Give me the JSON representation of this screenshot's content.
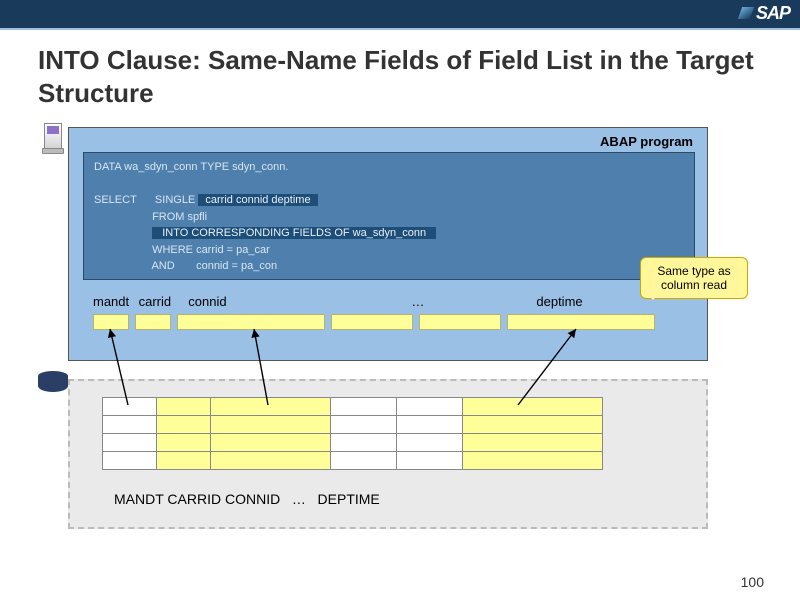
{
  "brand": "SAP",
  "title": "INTO Clause: Same-Name Fields of Field List in the Target Structure",
  "panel": {
    "label": "ABAP program",
    "code": {
      "l1": "DATA wa_sdyn_conn TYPE sdyn_conn.",
      "l2a": "SELECT      SINGLE ",
      "l2_hl": " carrid connid deptime ",
      "l3": "                   FROM spfli",
      "l4_hl": "  INTO CORRESPONDING FIELDS OF wa_sdyn_conn  ",
      "l5": "                   WHERE carrid = pa_car",
      "l6": "                   AND       connid = pa_con"
    },
    "struct_labels": {
      "mandt": "mandt",
      "carrid": "carrid",
      "connid": "connid",
      "ellipsis": "…",
      "deptime": "deptime"
    }
  },
  "callout": "Same type as column read",
  "db": {
    "labels": "MANDT CARRID CONNID   …   DEPTIME"
  },
  "pagenum": "100"
}
